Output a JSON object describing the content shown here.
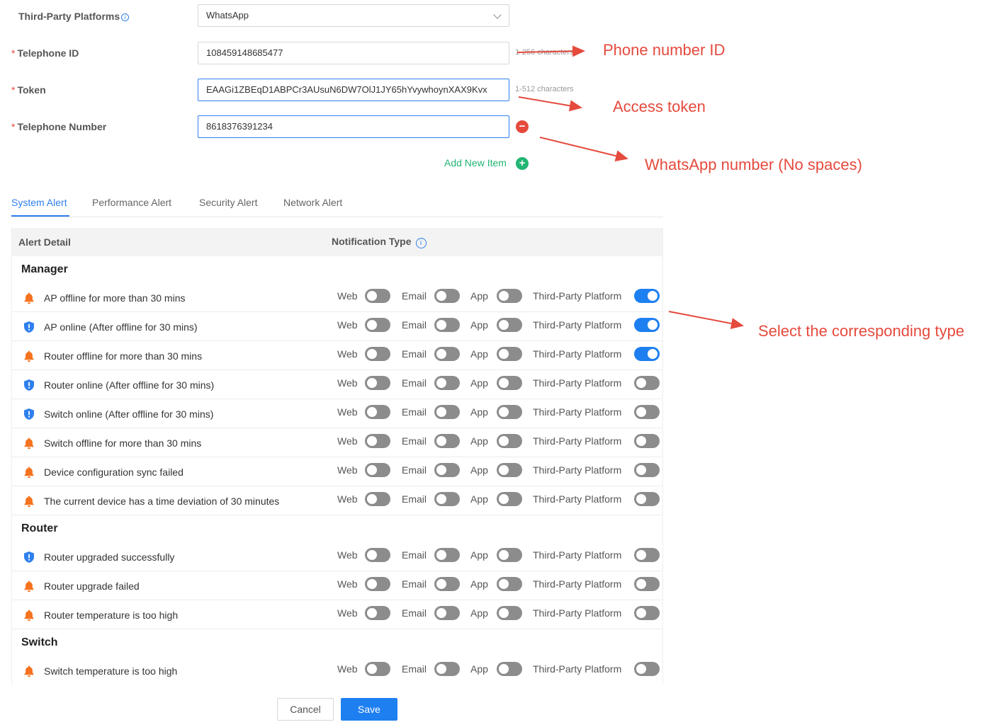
{
  "form": {
    "platform_label": "Third-Party Platforms",
    "platform_value": "WhatsApp",
    "telephone_id_label": "Telephone ID",
    "telephone_id_value": "108459148685477",
    "telephone_id_hint": "1-256 characters",
    "token_label": "Token",
    "token_value": "EAAGi1ZBEqD1ABPCr3AUsuN6DW7OlJ1JY65hYvywhoynXAX9Kvx",
    "token_hint": "1-512 characters",
    "telephone_number_label": "Telephone Number",
    "telephone_number_value": "8618376391234",
    "add_new_item": "Add New Item",
    "required_mark": "*",
    "remove_glyph": "−",
    "add_glyph": "+",
    "info_glyph": "i"
  },
  "annotations": {
    "phone_number_id": "Phone number ID",
    "access_token": "Access token",
    "whatsapp_number": "WhatsApp number (No spaces)",
    "select_type": "Select the corresponding type",
    "color": "#e54a3d"
  },
  "tabs": [
    "System Alert",
    "Performance Alert",
    "Security Alert",
    "Network Alert"
  ],
  "table": {
    "col_alert_detail": "Alert Detail",
    "col_notification_type": "Notification Type",
    "channel_labels": [
      "Web",
      "Email",
      "App",
      "Third-Party Platform"
    ],
    "groups": [
      {
        "title": "Manager",
        "rows": [
          {
            "icon": "bell-icon",
            "label": "AP offline for more than 30 mins",
            "states": [
              false,
              false,
              false,
              true
            ]
          },
          {
            "icon": "shield-icon",
            "label": "AP online (After offline for 30 mins)",
            "states": [
              false,
              false,
              false,
              true
            ]
          },
          {
            "icon": "bell-icon",
            "label": "Router offline for more than 30 mins",
            "states": [
              false,
              false,
              false,
              true
            ]
          },
          {
            "icon": "shield-icon",
            "label": "Router online (After offline for 30 mins)",
            "states": [
              false,
              false,
              false,
              false
            ]
          },
          {
            "icon": "shield-icon",
            "label": "Switch online (After offline for 30 mins)",
            "states": [
              false,
              false,
              false,
              false
            ]
          },
          {
            "icon": "bell-icon",
            "label": "Switch offline for more than 30 mins",
            "states": [
              false,
              false,
              false,
              false
            ]
          },
          {
            "icon": "bell-icon",
            "label": "Device configuration sync failed",
            "states": [
              false,
              false,
              false,
              false
            ]
          },
          {
            "icon": "bell-icon",
            "label": "The current device has a time deviation of 30 minutes",
            "states": [
              false,
              false,
              false,
              false
            ]
          }
        ]
      },
      {
        "title": "Router",
        "rows": [
          {
            "icon": "shield-icon",
            "label": "Router upgraded successfully",
            "states": [
              false,
              false,
              false,
              false
            ]
          },
          {
            "icon": "bell-icon",
            "label": "Router upgrade failed",
            "states": [
              false,
              false,
              false,
              false
            ]
          },
          {
            "icon": "bell-icon",
            "label": "Router temperature is too high",
            "states": [
              false,
              false,
              false,
              false
            ]
          }
        ]
      },
      {
        "title": "Switch",
        "rows": [
          {
            "icon": "bell-icon",
            "label": "Switch temperature is too high",
            "states": [
              false,
              false,
              false,
              false
            ]
          }
        ]
      }
    ]
  },
  "footer": {
    "cancel": "Cancel",
    "save": "Save"
  },
  "colors": {
    "primary": "#1e7ff0",
    "success": "#22b573",
    "danger": "#e54a3d",
    "bell": "#f5731f",
    "shield": "#2f80ed",
    "switch_off": "#8c8c8c"
  }
}
